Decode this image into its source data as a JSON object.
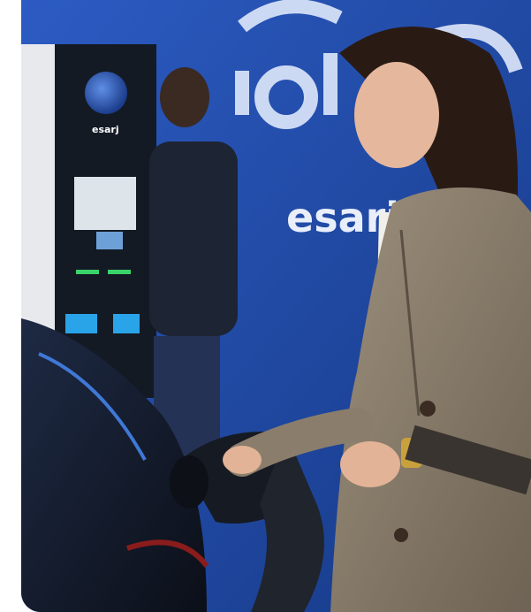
{
  "scene": {
    "kiosk_logo_text": "esarj",
    "banner_text": "esarj.co",
    "colors": {
      "banner_blue": "#2552b8",
      "banner_dark": "#173a86",
      "kiosk_body": "#141a24",
      "kiosk_side": "#e7e9ec",
      "blazer": "#8c7f6e",
      "man_jacket": "#1d2433",
      "car": "#121826",
      "accent_green": "#39d36a",
      "screen_blue": "#2aa4e8"
    }
  }
}
